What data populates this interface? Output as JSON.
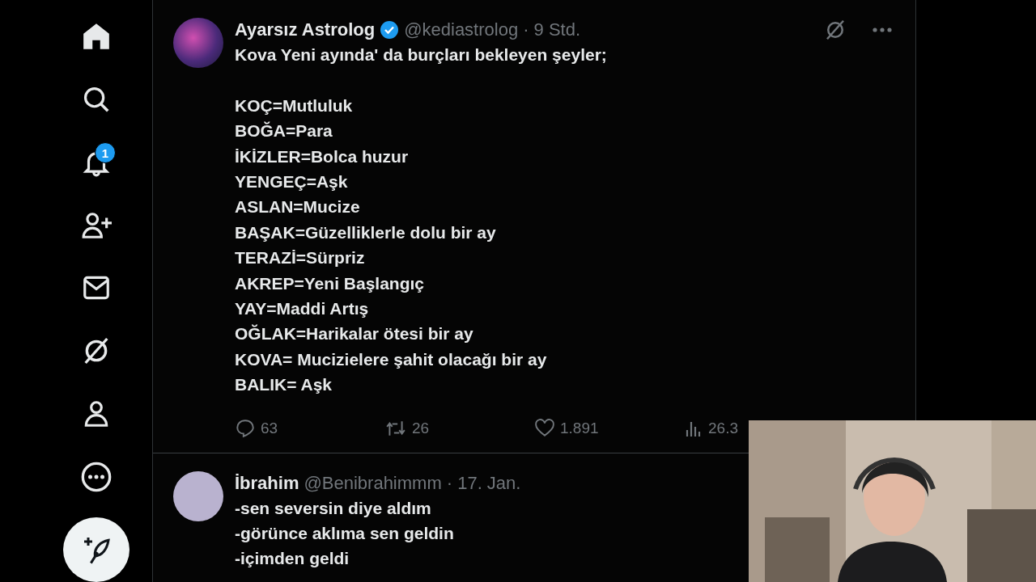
{
  "sidebar": {
    "notification_badge": "1"
  },
  "tweets": [
    {
      "name": "Ayarsız Astrolog",
      "verified": true,
      "handle": "@kediastrolog",
      "time": "· 9 Std.",
      "intro": "Kova Yeni ayında' da burçları bekleyen şeyler;",
      "lines": [
        "KOÇ=Mutluluk",
        "BOĞA=Para",
        "İKİZLER=Bolca huzur",
        "YENGEÇ=Aşk",
        "ASLAN=Mucize",
        "BAŞAK=Güzelliklerle dolu bir ay",
        "TERAZİ=Sürpriz",
        "AKREP=Yeni Başlangıç",
        "YAY=Maddi Artış",
        "OĞLAK=Harikalar ötesi bir ay",
        "KOVA= Mucizielere şahit olacağı bir ay",
        "BALIK= Aşk"
      ],
      "menu": true,
      "stats": {
        "replies": "63",
        "reposts": "26",
        "likes": "1.891",
        "views": "26.3"
      }
    },
    {
      "name": "İbrahim",
      "verified": false,
      "handle": "@Benibrahimmm",
      "time": "· 17. Jan.",
      "lines": [
        "-sen seversin diye aldım",
        "-görünce aklıma sen geldin",
        "-içimden geldi"
      ]
    }
  ]
}
